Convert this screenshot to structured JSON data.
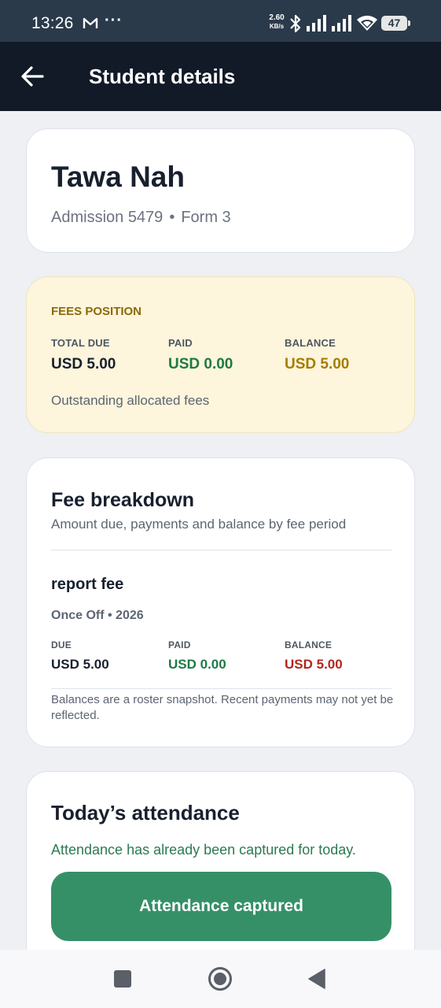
{
  "status_bar": {
    "time": "13:26",
    "dots": "···",
    "speed_value": "2.60",
    "speed_unit": "KB/s",
    "battery": "47",
    "icons": [
      "gmail-icon",
      "bluetooth-icon",
      "signal-icon",
      "signal-icon",
      "wifi-icon",
      "battery-icon"
    ]
  },
  "app_bar": {
    "back_icon": "arrow-left-icon",
    "title": "Student details"
  },
  "student": {
    "name": "Tawa Nah",
    "admission": "Admission 5479",
    "separator": "•",
    "form": "Form 3"
  },
  "fees_position": {
    "heading": "FEES POSITION",
    "total_due_label": "TOTAL DUE",
    "total_due_value": "USD 5.00",
    "paid_label": "PAID",
    "paid_value": "USD 0.00",
    "balance_label": "BALANCE",
    "balance_value": "USD 5.00",
    "note": "Outstanding allocated fees"
  },
  "fee_breakdown": {
    "title": "Fee breakdown",
    "subtitle": "Amount due, payments and balance by fee period",
    "items": [
      {
        "name": "report fee",
        "period": "Once Off • 2026",
        "due_label": "DUE",
        "due_value": "USD 5.00",
        "paid_label": "PAID",
        "paid_value": "USD 0.00",
        "balance_label": "BALANCE",
        "balance_value": "USD 5.00"
      }
    ],
    "note": "Balances are a roster snapshot. Recent payments may not yet be reflected."
  },
  "attendance": {
    "title": "Today’s attendance",
    "message": "Attendance has already been captured for today.",
    "button_label": "Attendance captured"
  },
  "colors": {
    "app_bar": "#121a28",
    "fees_bg": "#fdf5dc",
    "paid_green": "#1d7a45",
    "balance_gold": "#a67c00",
    "balance_red": "#b3261e",
    "button_green": "#359068"
  },
  "nav_bar": {
    "icons": [
      "recent-apps-icon",
      "home-icon",
      "back-nav-icon"
    ]
  }
}
